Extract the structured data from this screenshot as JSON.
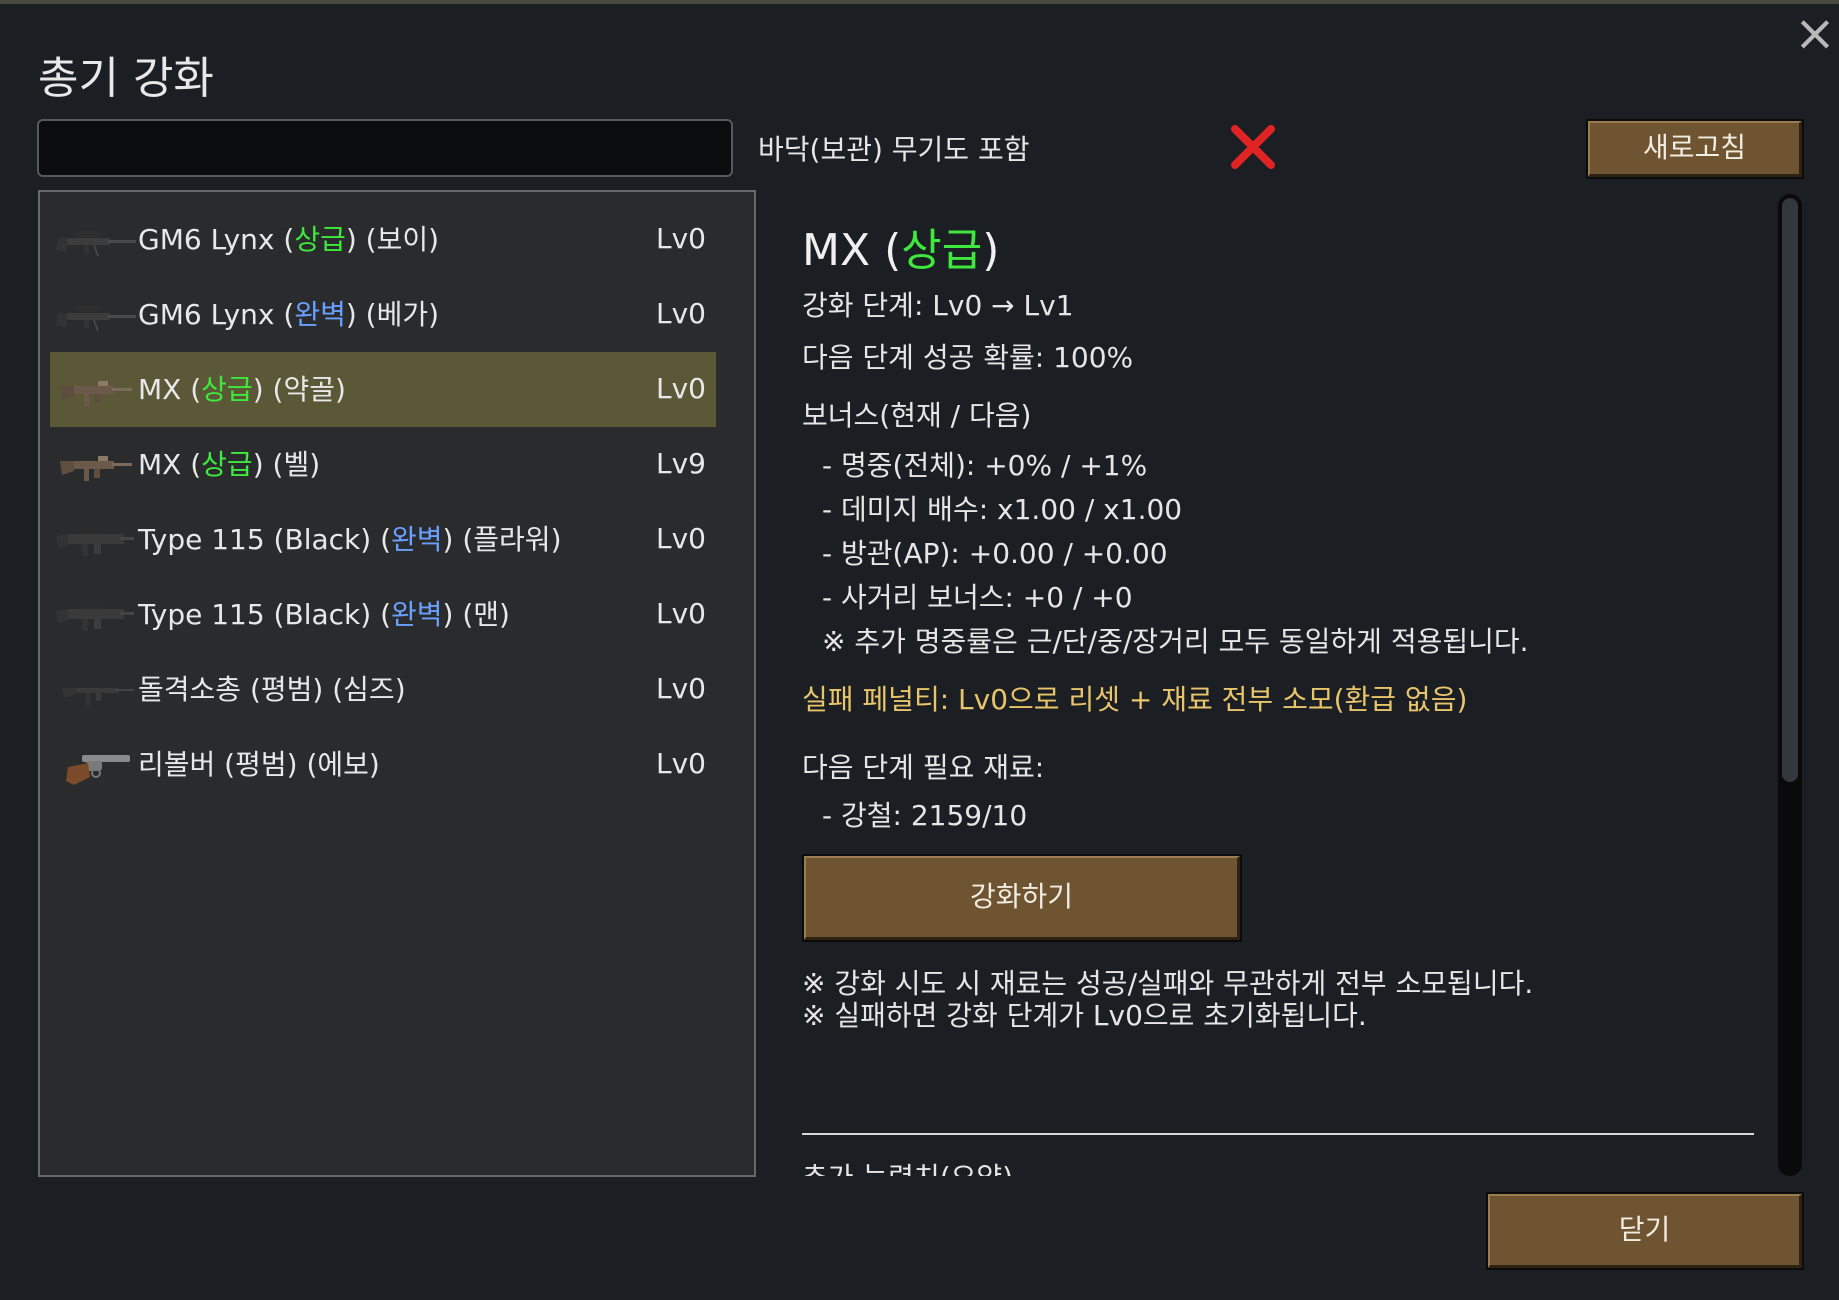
{
  "dialog": {
    "title": "총기 강화",
    "close_icon": "close-x-icon"
  },
  "toolbar": {
    "search_value": "",
    "include_floor_label": "바닥(보관) 무기도 포함",
    "include_floor_checked": false,
    "include_floor_icon": "red-x-icon",
    "refresh_label": "새로고침"
  },
  "weapons": [
    {
      "name": "GM6 Lynx",
      "quality": "상급",
      "quality_color": "#3ee83e",
      "owner": "보이",
      "level": "Lv0",
      "icon": "sniper-rifle-icon",
      "selected": false
    },
    {
      "name": "GM6 Lynx",
      "quality": "완벽",
      "quality_color": "#6aa0ff",
      "owner": "베가",
      "level": "Lv0",
      "icon": "sniper-rifle-icon",
      "selected": false
    },
    {
      "name": "MX",
      "quality": "상급",
      "quality_color": "#3ee83e",
      "owner": "약골",
      "level": "Lv0",
      "icon": "smg-icon",
      "selected": true
    },
    {
      "name": "MX",
      "quality": "상급",
      "quality_color": "#3ee83e",
      "owner": "벨",
      "level": "Lv9",
      "icon": "smg-icon",
      "selected": false
    },
    {
      "name": "Type 115 (Black)",
      "quality": "완벽",
      "quality_color": "#6aa0ff",
      "owner": "플라워",
      "level": "Lv0",
      "icon": "assault-rifle-icon",
      "selected": false
    },
    {
      "name": "Type 115 (Black)",
      "quality": "완벽",
      "quality_color": "#6aa0ff",
      "owner": "맨",
      "level": "Lv0",
      "icon": "assault-rifle-icon",
      "selected": false
    },
    {
      "name": "돌격소총",
      "quality": "평범",
      "quality_color": "#e8e8e8",
      "owner": "심즈",
      "level": "Lv0",
      "icon": "rifle-icon",
      "selected": false
    },
    {
      "name": "리볼버",
      "quality": "평범",
      "quality_color": "#e8e8e8",
      "owner": "에보",
      "level": "Lv0",
      "icon": "revolver-icon",
      "selected": false
    }
  ],
  "detail": {
    "title_name": "MX",
    "title_quality": "상급",
    "stage_line": "강화 단계: Lv0 → Lv1",
    "success_line": "다음 단계 성공 확률: 100%",
    "bonus_header": "보너스(현재 / 다음)",
    "bonus_accuracy": "- 명중(전체): +0% / +1%",
    "bonus_damage": "- 데미지 배수: x1.00 / x1.00",
    "bonus_ap": "- 방관(AP): +0.00 / +0.00",
    "bonus_range": "- 사거리 보너스: +0 / +0",
    "bonus_note": "※ 추가 명중률은 근/단/중/장거리 모두 동일하게 적용됩니다.",
    "penalty": "실패 페널티: Lv0으로 리셋 + 재료 전부 소모(환급 없음)",
    "materials_header": "다음 단계 필요 재료:",
    "material_steel": "- 강철: 2159/10",
    "enhance_label": "강화하기",
    "note1": "※ 강화 시도 시 재료는 성공/실패와 무관하게 전부 소모됩니다.",
    "note2": "※ 실패하면 강화 단계가 Lv0으로 초기화됩니다.",
    "extra_header": "추가 능력치(요약)"
  },
  "footer": {
    "close_label": "닫기"
  },
  "colors": {
    "button_bg": "#6e5430",
    "selected_row": "#5a5837",
    "quality_great": "#3ee83e",
    "quality_perfect": "#6aa0ff",
    "penalty_text": "#e8c56a"
  }
}
